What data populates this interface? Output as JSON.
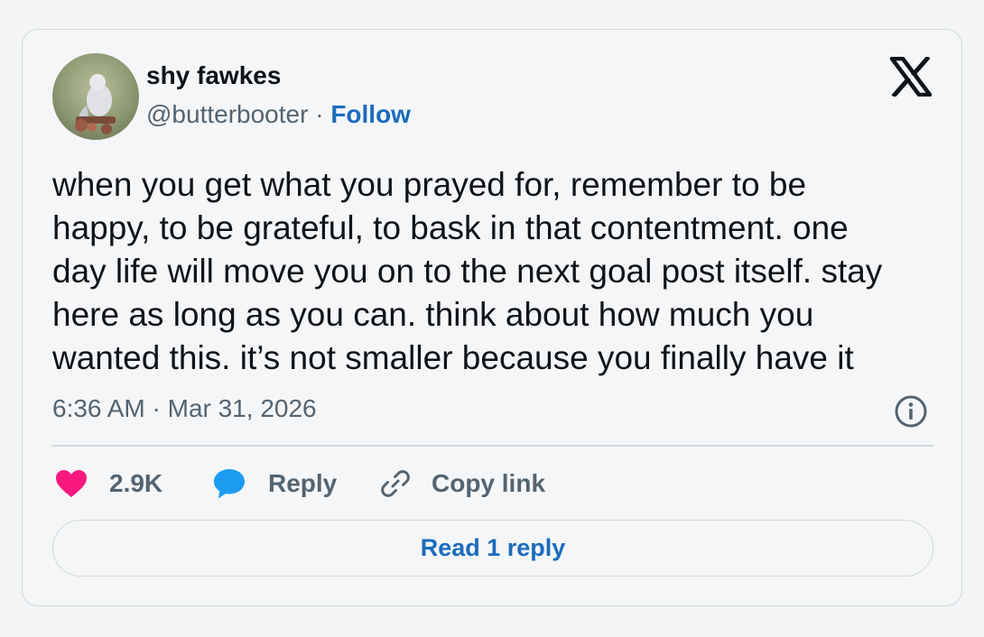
{
  "author": {
    "display_name": "shy fawkes",
    "handle": "@butterbooter",
    "separator": " · ",
    "follow_label": "Follow"
  },
  "tweet": {
    "text": "when you get what you prayed for, remember to be\nhappy, to be grateful, to bask in that contentment. one\nday life will move you on to the next goal post itself. stay\nhere as long as you can. think about how much you\nwanted this. it’s not smaller because you finally have it",
    "timestamp": "6:36 AM · Mar 31, 2026"
  },
  "actions": {
    "like_count": "2.9K",
    "reply_label": "Reply",
    "copy_link_label": "Copy link"
  },
  "read_reply_label": "Read 1 reply",
  "icons": {
    "brand": "x-logo-icon",
    "info": "info-icon",
    "like": "heart-icon",
    "reply": "speech-bubble-icon",
    "copy": "link-icon"
  },
  "colors": {
    "text": "#0f1419",
    "secondary": "#536471",
    "link": "#1b6bbd",
    "like": "#f91880",
    "reply": "#1d9bf0",
    "border": "#cfd9de"
  }
}
